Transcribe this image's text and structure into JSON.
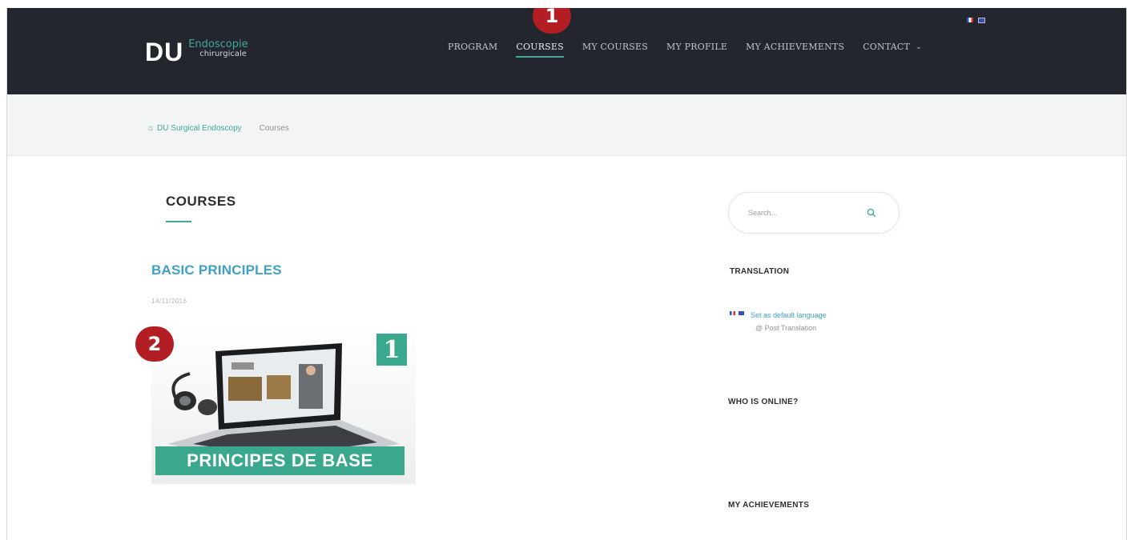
{
  "header": {
    "logo_main": "DU",
    "logo_sub_line1": "Endoscopie",
    "logo_sub_line2": "chirurgicale",
    "nav": [
      "PROGRAM",
      "COURSES",
      "MY COURSES",
      "MY PROFILE",
      "MY ACHIEVEMENTS",
      "CONTACT"
    ],
    "active_nav": "COURSES",
    "contact_caret": "⌄"
  },
  "breadcrumb": {
    "home": "DU Surgical Endoscopy",
    "current": "Courses"
  },
  "main": {
    "page_title": "COURSES",
    "course": {
      "title": "BASIC PRINCIPLES",
      "date": "14/11/2016",
      "thumb_number": "1",
      "thumb_banner": "PRINCIPES DE BASE"
    }
  },
  "sidebar": {
    "search_placeholder": "Search...",
    "translation_heading": "TRANSLATION",
    "translation_link": "Set as default language",
    "translation_note": "@ Post Translation",
    "online_heading": "WHO IS ONLINE?",
    "achievements_heading": "MY ACHIEVEMENTS"
  },
  "annotations": {
    "badge1": "1",
    "badge2": "2"
  },
  "colors": {
    "nav_bg": "#23272d",
    "accent": "#3fa89a",
    "link": "#3fa1c7",
    "badge": "#b31d24"
  }
}
